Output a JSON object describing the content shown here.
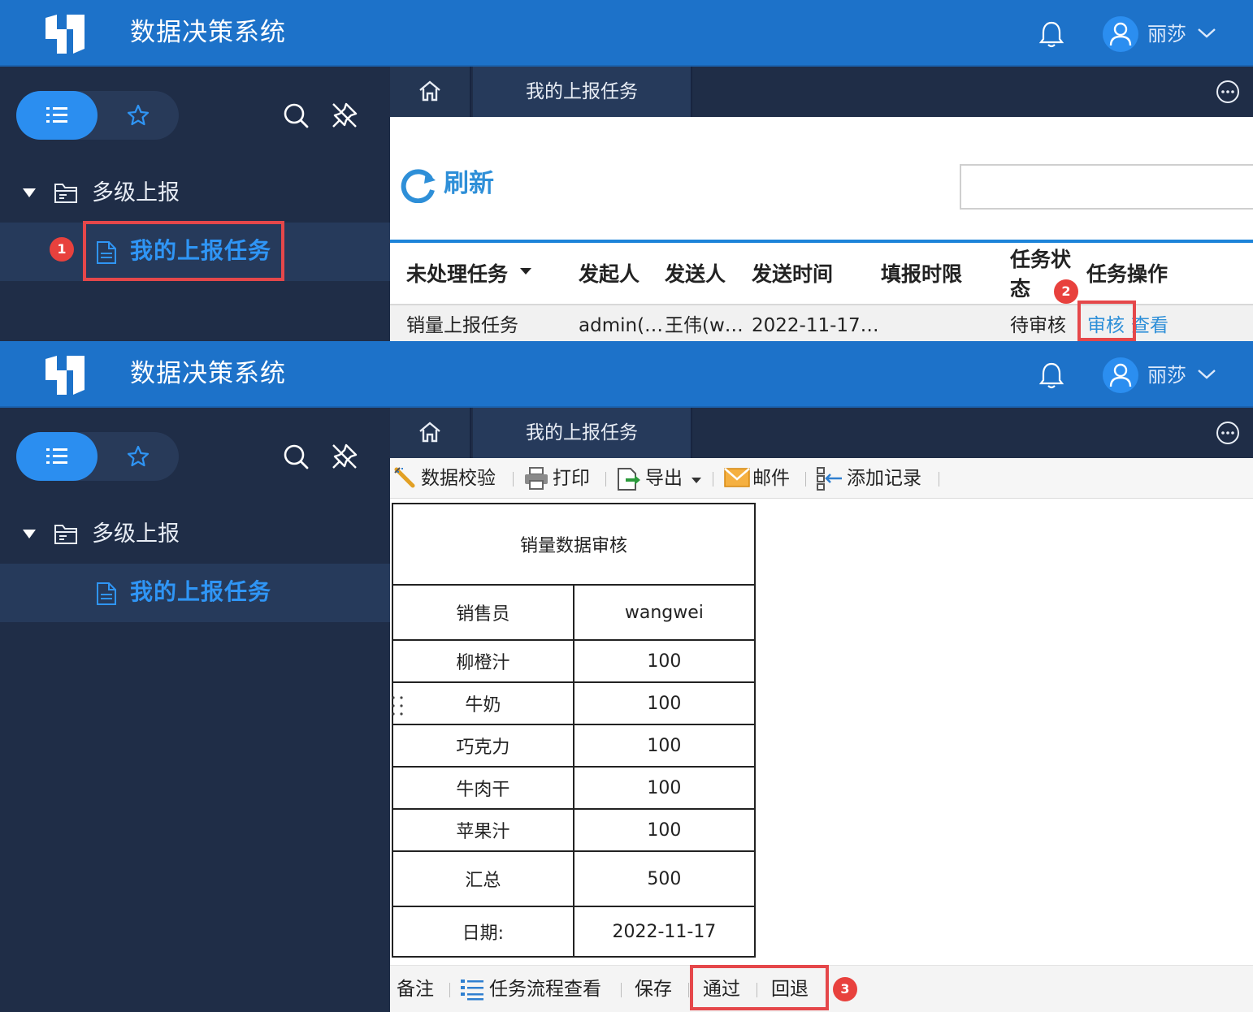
{
  "app": {
    "title": "数据决策系统",
    "user_name": "丽莎"
  },
  "sidebar": {
    "folder_label": "多级上报",
    "item_label": "我的上报任务"
  },
  "tabs": {
    "active_label": "我的上报任务"
  },
  "task_list": {
    "refresh_label": "刷新",
    "search_value": "",
    "headers": {
      "task": "未处理任务",
      "initiator": "发起人",
      "sender": "发送人",
      "send_time": "发送时间",
      "deadline": "填报时限",
      "status_line1": "任务状",
      "status_line2": "态",
      "actions": "任务操作"
    },
    "rows": [
      {
        "task": "销量上报任务",
        "initiator": "admin(…",
        "sender": "王伟(w…",
        "send_time": "2022-11-17…",
        "deadline": "",
        "status": "待审核",
        "action_review": "审核",
        "action_view": "查看"
      }
    ]
  },
  "toolbar": {
    "validate": "数据校验",
    "print": "打印",
    "export": "导出",
    "email": "邮件",
    "add_record": "添加记录"
  },
  "report": {
    "title": "销量数据审核",
    "salesperson_label": "销售员",
    "salesperson_value": "wangwei",
    "items": [
      {
        "name": "柳橙汁",
        "value": "100"
      },
      {
        "name": "牛奶",
        "value": "100"
      },
      {
        "name": "巧克力",
        "value": "100"
      },
      {
        "name": "牛肉干",
        "value": "100"
      },
      {
        "name": "苹果汁",
        "value": "100"
      }
    ],
    "total_label": "汇总",
    "total_value": "500",
    "date_label": "日期:",
    "date_value": "2022-11-17"
  },
  "bottom_bar": {
    "remark": "备注",
    "flow_view": "任务流程查看",
    "save": "保存",
    "approve": "通过",
    "reject": "回退"
  },
  "callouts": {
    "step1": "1",
    "step2": "2",
    "step3": "3"
  },
  "colors": {
    "header_blue": "#1d72c9",
    "sidebar_navy": "#1f2d47",
    "accent_blue": "#2f95f5",
    "highlight_red": "#e5474a"
  }
}
